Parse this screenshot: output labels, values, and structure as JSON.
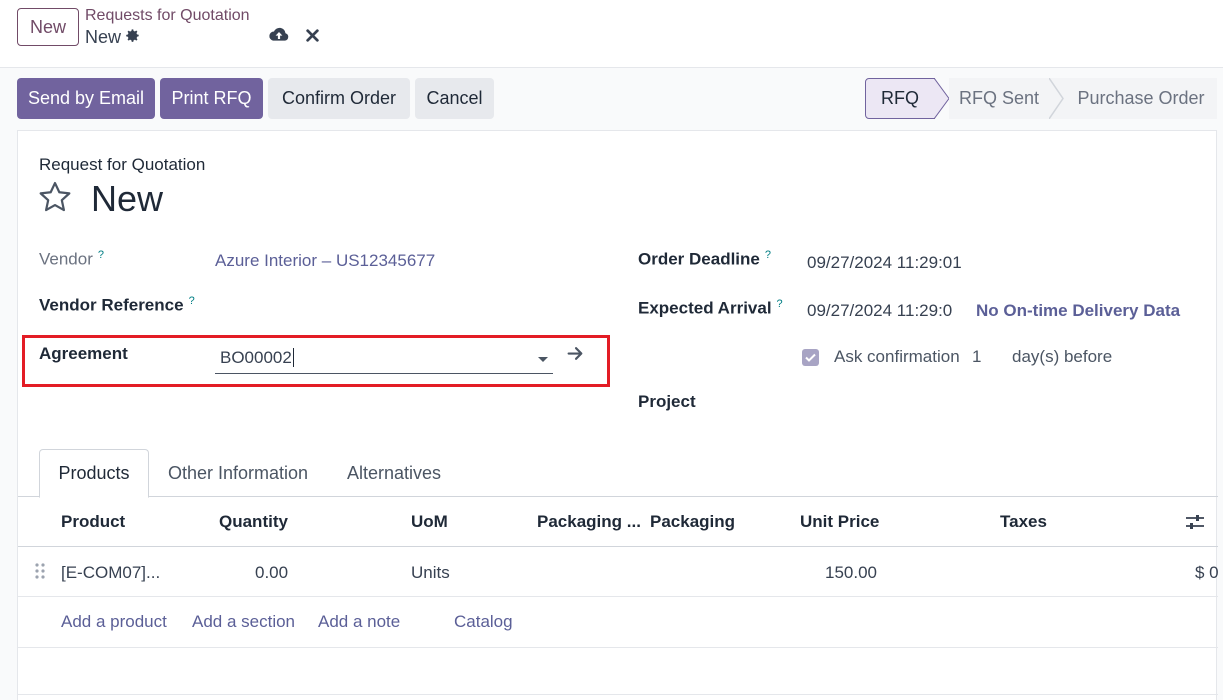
{
  "topbar": {
    "new_label": "New",
    "breadcrumb": "Requests for Quotation",
    "record_name": "New"
  },
  "actions": {
    "send_email": "Send by Email",
    "print_rfq": "Print RFQ",
    "confirm_order": "Confirm Order",
    "cancel": "Cancel"
  },
  "status": {
    "stages": [
      "RFQ",
      "RFQ Sent",
      "Purchase Order"
    ],
    "active": "RFQ"
  },
  "form": {
    "doc_type": "Request for Quotation",
    "title": "New",
    "vendor_label": "Vendor",
    "vendor_value": "Azure Interior – US12345677",
    "vendor_ref_label": "Vendor Reference",
    "agreement_label": "Agreement",
    "agreement_value": "BO00002",
    "order_deadline_label": "Order Deadline",
    "order_deadline_value": "09/27/2024 11:29:01",
    "expected_arrival_label": "Expected Arrival",
    "expected_arrival_value": "09/27/2024 11:29:0",
    "delivery_data": "No On-time Delivery Data",
    "ask_confirmation_label": "Ask confirmation",
    "ask_confirmation_days": "1",
    "days_before": "day(s) before",
    "project_label": "Project",
    "help_mark": "?"
  },
  "tabs": [
    "Products",
    "Other Information",
    "Alternatives"
  ],
  "table": {
    "headers": [
      "Product",
      "Quantity",
      "UoM",
      "Packaging ...",
      "Packaging",
      "Unit Price",
      "Taxes"
    ],
    "rows": [
      {
        "product": "[E-COM07]...",
        "quantity": "0.00",
        "uom": "Units",
        "unit_price": "150.00",
        "subtotal": "$ 0"
      }
    ],
    "add_product": "Add a product",
    "add_section": "Add a section",
    "add_note": "Add a note",
    "catalog": "Catalog"
  },
  "colors": {
    "primary": "#71639e",
    "brand": "#714b67",
    "highlight": "#e31c25"
  }
}
